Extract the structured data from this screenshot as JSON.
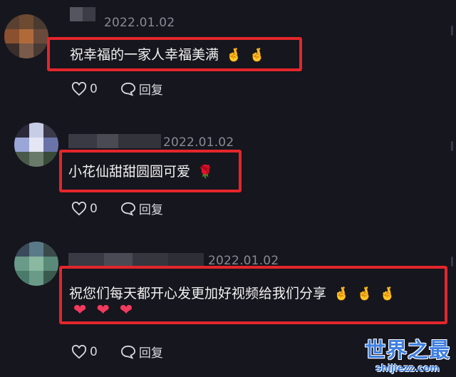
{
  "comments": [
    {
      "date": "2022.01.02",
      "text": "祝幸福的一家人幸福美满",
      "emojis": [
        "🤞",
        "🤞"
      ],
      "likes": "0",
      "reply_label": "回复"
    },
    {
      "date": "2022.01.02",
      "text": "小花仙甜甜圆圆可爱",
      "emojis": [
        "🌹"
      ],
      "likes": "0",
      "reply_label": "回复"
    },
    {
      "date": "2022.01.02",
      "text": "祝您们每天都开心发更加好视频给我们分享",
      "emojis": [
        "🤞",
        "🤞",
        "🤞"
      ],
      "second_line_emojis": [
        "❤",
        "❤",
        "❤"
      ],
      "likes": "0",
      "reply_label": "回复"
    }
  ],
  "icons": {
    "like": "heart-outline-icon",
    "reply": "speech-bubble-icon"
  },
  "colors": {
    "highlight": "#e3262b",
    "background": "#16161e",
    "watermark": "#3f7fe0"
  },
  "watermark": {
    "logo": "世界之最",
    "url": "shijiezz.com"
  }
}
